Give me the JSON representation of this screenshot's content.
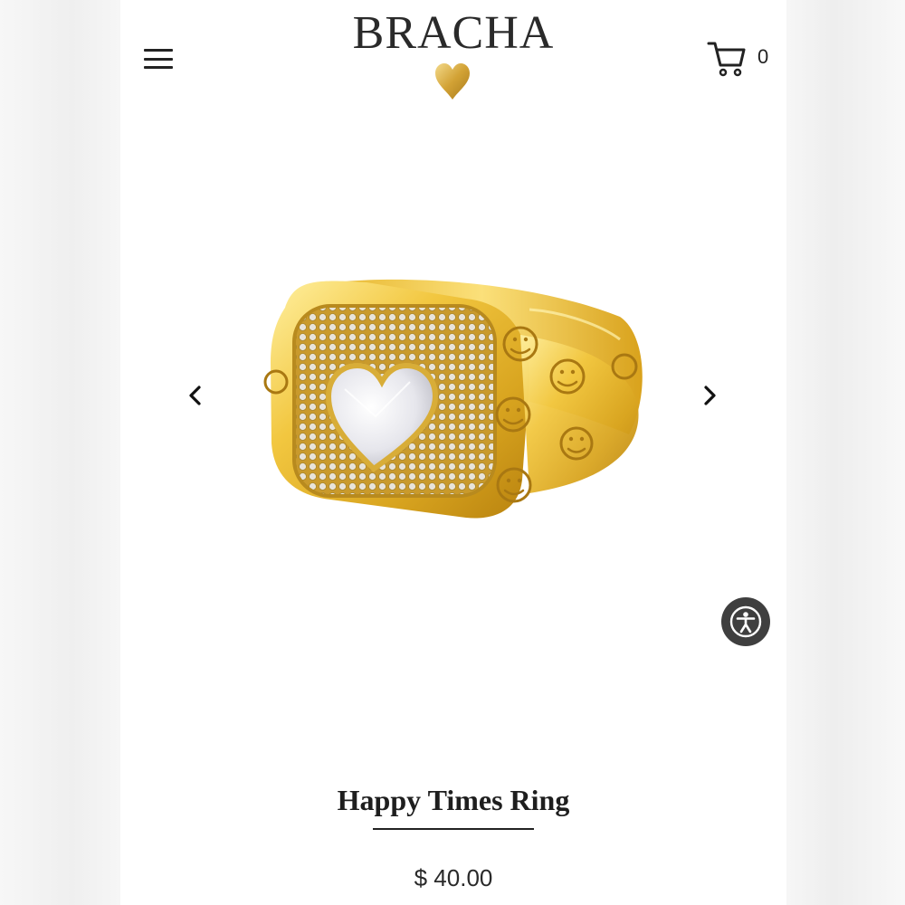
{
  "brand": {
    "name": "BRACHA",
    "logo_icon": "gold-heart-icon",
    "accent": "#d9ad3c"
  },
  "header": {
    "menu_icon": "hamburger-menu-icon",
    "cart_icon": "shopping-cart-icon",
    "cart_count": "0"
  },
  "gallery": {
    "prev_icon": "chevron-left-icon",
    "next_icon": "chevron-right-icon",
    "image": "gold-signet-ring-heart-stone-smiley-engravings"
  },
  "accessibility": {
    "icon": "accessibility-person-icon"
  },
  "product": {
    "title": "Happy Times Ring",
    "price": "$ 40.00"
  }
}
